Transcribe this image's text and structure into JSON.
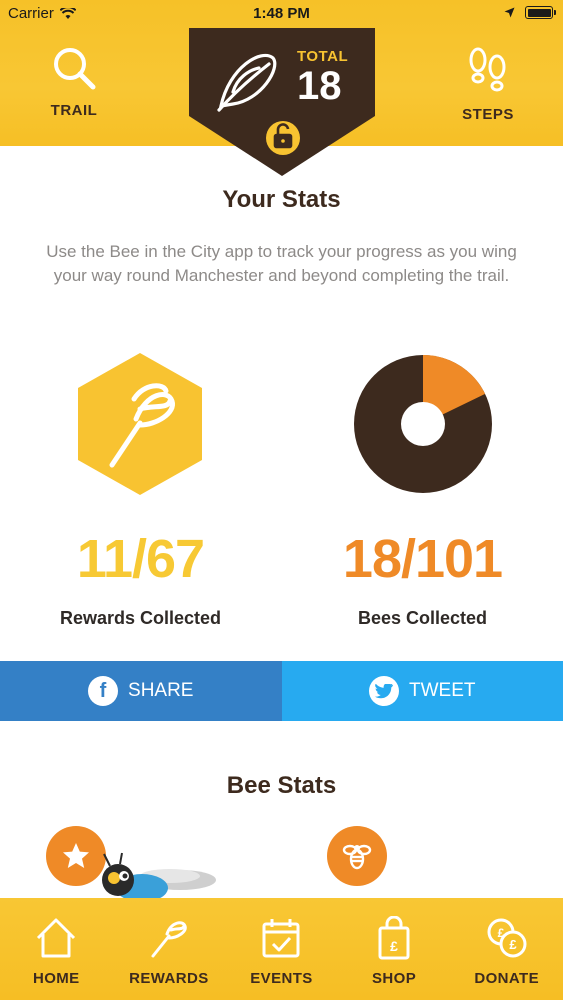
{
  "status_bar": {
    "carrier": "Carrier",
    "time": "1:48 PM"
  },
  "header": {
    "left_nav_label": "TRAIL",
    "right_nav_label": "STEPS",
    "badge_total_label": "TOTAL",
    "badge_total_value": "18"
  },
  "stats": {
    "title": "Your Stats",
    "intro": "Use the Bee in the City app to track your progress as you wing your way round Manchester and beyond completing the trail.",
    "rewards_value": "11/67",
    "rewards_label": "Rewards Collected",
    "bees_value": "18/101",
    "bees_label": "Bees Collected",
    "bees_collected": 18,
    "bees_total": 101
  },
  "share": {
    "facebook_label": "SHARE",
    "twitter_label": "TWEET"
  },
  "bee_stats": {
    "title": "Bee Stats"
  },
  "tabbar": {
    "items": [
      {
        "label": "HOME",
        "icon": "home-icon"
      },
      {
        "label": "REWARDS",
        "icon": "rewards-icon"
      },
      {
        "label": "EVENTS",
        "icon": "events-icon"
      },
      {
        "label": "SHOP",
        "icon": "shop-icon"
      },
      {
        "label": "DONATE",
        "icon": "donate-icon"
      }
    ]
  },
  "colors": {
    "brand_yellow": "#f8c734",
    "dark_brown": "#3d2a1e",
    "orange": "#ef8a27",
    "facebook_blue": "#3480c6",
    "twitter_blue": "#27aaf0"
  }
}
